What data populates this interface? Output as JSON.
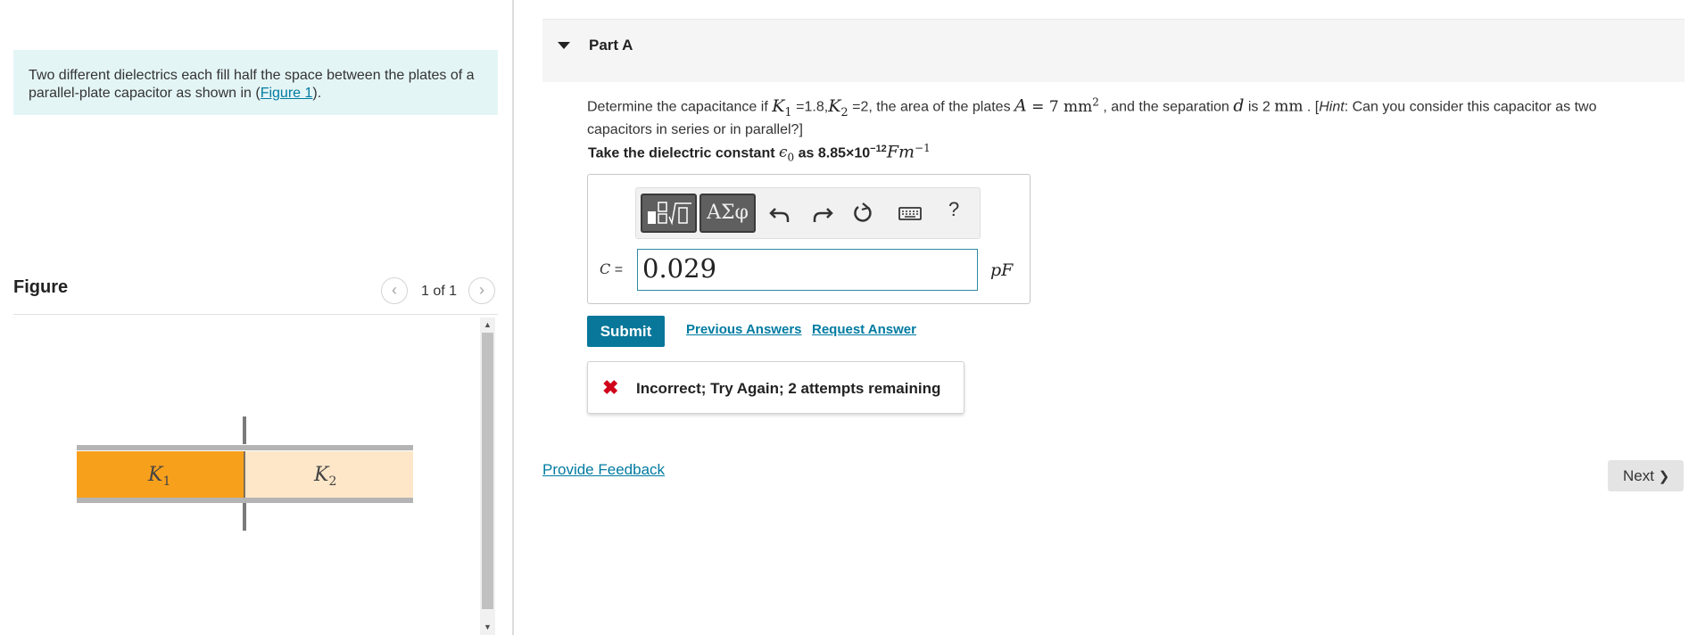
{
  "intro": {
    "text_before_link": "Two different dielectrics each fill half the space between the plates of a parallel-plate capacitor as shown in (",
    "link": "Figure 1",
    "text_after_link": ")."
  },
  "figure": {
    "title": "Figure",
    "pager_text": "1 of 1",
    "prev_icon": "‹",
    "next_icon": "›",
    "labels": {
      "k1": "K",
      "k1_sub": "1",
      "k2": "K",
      "k2_sub": "2"
    },
    "colors": {
      "k1_fill": "#f7a01c",
      "k2_fill": "#fde7c8",
      "plate": "#b4b4b4"
    }
  },
  "part": {
    "title": "Part A"
  },
  "question": {
    "t1": "Determine  the capacitance if ",
    "k1": "K",
    "k1_sub": "1",
    "k1_val": " =1.8,",
    "k2": "K",
    "k2_sub": "2",
    "k2_val": " =2, the area of the plates  ",
    "a_var": "A",
    "a_eq": " = 7 mm",
    "a_exp": "2",
    "t2": " , and the separation  ",
    "d_var": "d",
    "t3": " is 2 ",
    "d_unit": "mm",
    "t4": " . [",
    "hint_label": "Hint",
    "hint_text": ": Can you consider this capacitor as two capacitors in series or in parallel?]"
  },
  "constant": {
    "prefix": "Take the dielectric constant ",
    "eps": "ϵ",
    "eps_sub": "0",
    "mid": "  as 8.85×10",
    "exp": "−12",
    "unit": "Fm",
    "unit_exp": "−1"
  },
  "answer": {
    "toolbar": {
      "greek_label": "ΑΣφ",
      "help_label": "?"
    },
    "var_label": "C",
    "eq": " =",
    "value": "0.029",
    "unit": "pF"
  },
  "actions": {
    "submit": "Submit",
    "previous_answers": "Previous Answers",
    "request_answer": "Request Answer"
  },
  "feedback": {
    "icon": "✖",
    "text": "Incorrect; Try Again; 2 attempts remaining"
  },
  "footer": {
    "provide_feedback": "Provide Feedback",
    "next": "Next",
    "next_icon": "❯"
  },
  "colors": {
    "accent": "#08779a",
    "link": "#007ba1",
    "error": "#d0021b",
    "intro_bg": "#e4f5f6"
  }
}
